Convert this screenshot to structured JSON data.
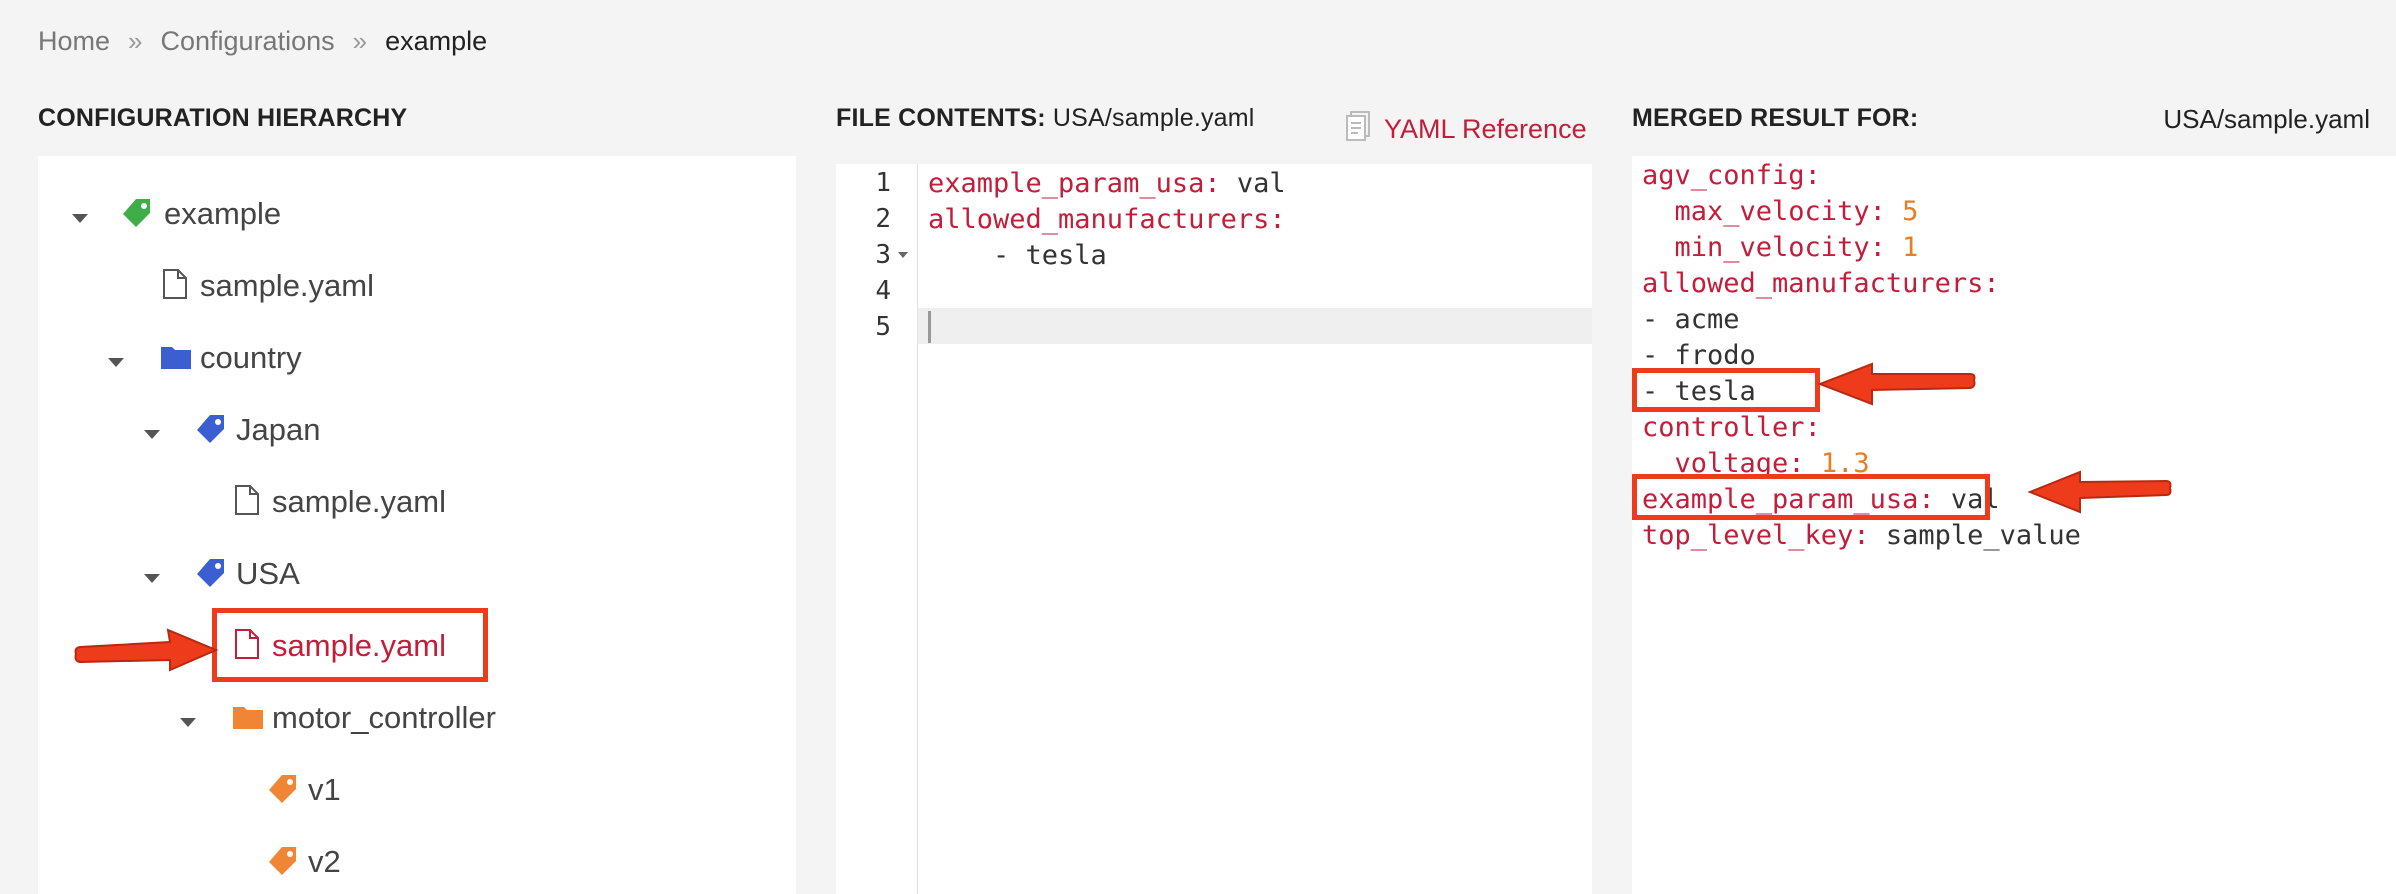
{
  "breadcrumb": {
    "home": "Home",
    "separator": "»",
    "configurations": "Configurations",
    "current": "example"
  },
  "hierarchy": {
    "heading": "CONFIGURATION HIERARCHY",
    "nodes": [
      {
        "label": "example",
        "icon": "tag-icon",
        "color": "#3fae49"
      },
      {
        "label": "sample.yaml",
        "icon": "file-icon"
      },
      {
        "label": "country",
        "icon": "folder-icon",
        "color": "#3b5fd0"
      },
      {
        "label": "Japan",
        "icon": "tag-icon",
        "color": "#3b5fd0"
      },
      {
        "label": "sample.yaml",
        "icon": "file-icon"
      },
      {
        "label": "USA",
        "icon": "tag-icon",
        "color": "#3b5fd0"
      },
      {
        "label": "sample.yaml",
        "icon": "file-icon",
        "selected": true
      },
      {
        "label": "motor_controller",
        "icon": "folder-icon",
        "color": "#ef8535"
      },
      {
        "label": "v1",
        "icon": "tag-icon",
        "color": "#ef8535"
      },
      {
        "label": "v2",
        "icon": "tag-icon",
        "color": "#ef8535"
      }
    ]
  },
  "file_contents": {
    "heading": "FILE CONTENTS:",
    "path": "USA/sample.yaml",
    "reference_link": "YAML Reference",
    "line_numbers": [
      "1",
      "2",
      "3",
      "4",
      "5"
    ],
    "lines": [
      {
        "key": "example_param_usa",
        "colon": ":",
        "value": " val"
      },
      {
        "key": "allowed_manufacturers",
        "colon": ":",
        "value": ""
      },
      {
        "key": "",
        "colon": "",
        "value": "    - tesla"
      }
    ]
  },
  "merged": {
    "heading": "MERGED RESULT FOR:",
    "path": "USA/sample.yaml",
    "lines": [
      {
        "key": "agv_config",
        "colon": ":",
        "value": ""
      },
      {
        "key": "  max_velocity",
        "colon": ":",
        "value": " 5",
        "numeric": true
      },
      {
        "key": "  min_velocity",
        "colon": ":",
        "value": " 1",
        "numeric": true
      },
      {
        "key": "allowed_manufacturers",
        "colon": ":",
        "value": ""
      },
      {
        "key": "",
        "colon": "",
        "value": "- acme"
      },
      {
        "key": "",
        "colon": "",
        "value": "- frodo"
      },
      {
        "key": "",
        "colon": "",
        "value": "- tesla"
      },
      {
        "key": "controller",
        "colon": ":",
        "value": ""
      },
      {
        "key": "  voltage",
        "colon": ":",
        "value": " 1.3",
        "numeric": true
      },
      {
        "key": "example_param_usa",
        "colon": ":",
        "value": " val"
      },
      {
        "key": "top_level_key",
        "colon": ":",
        "value": " sample_value"
      }
    ]
  },
  "colors": {
    "accent_red": "#c21e3a",
    "highlight_red": "#ee3b1c",
    "number_orange": "#e67e22"
  }
}
